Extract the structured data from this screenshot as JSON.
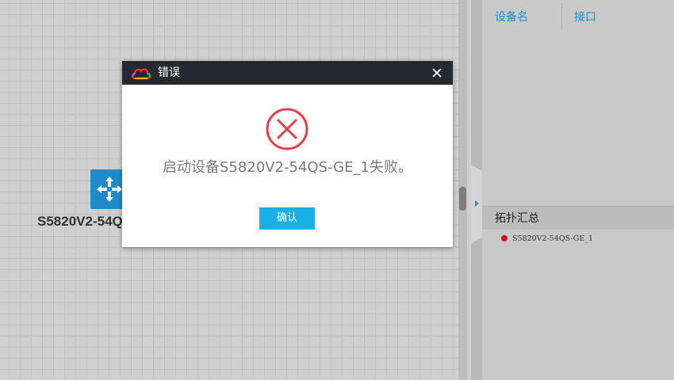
{
  "topology": {
    "device_label": "S5820V2-54Q",
    "device_icon": "network-switch-icon"
  },
  "right_panel": {
    "columns": [
      "设备名",
      "接口"
    ],
    "summary_title": "拓扑汇总",
    "summary_items": [
      {
        "name": "S5820V2-54QS-GE_1",
        "status_color": "#c8161d"
      }
    ]
  },
  "dialog": {
    "title": "错误",
    "message": "启动设备S5820V2-54QS-GE_1失败。",
    "confirm_label": "确认",
    "logo_icon": "cloud-logo-icon",
    "close_icon": "close-icon",
    "error_icon": "error-circle-x-icon",
    "error_color": "#e2404d",
    "accent_color": "#19b0e8"
  }
}
